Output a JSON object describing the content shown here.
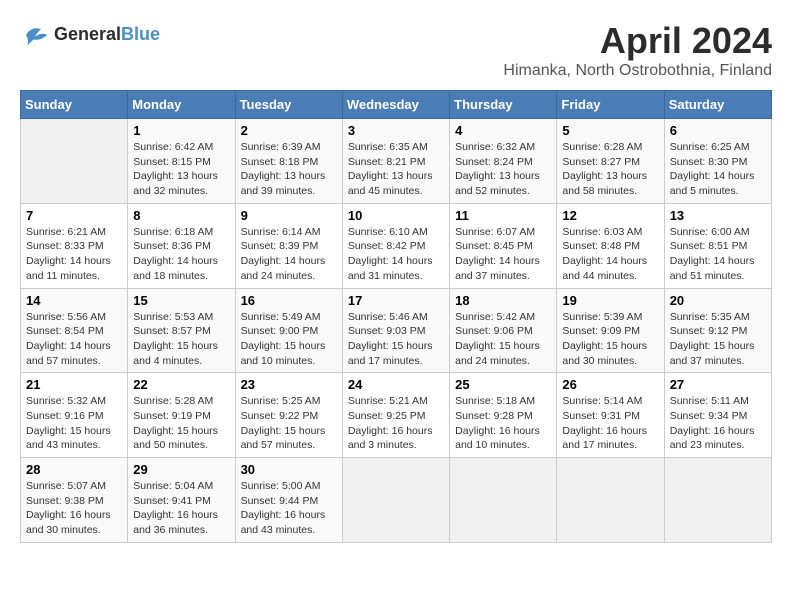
{
  "header": {
    "logo_line1": "General",
    "logo_line2": "Blue",
    "month": "April 2024",
    "location": "Himanka, North Ostrobothnia, Finland"
  },
  "weekdays": [
    "Sunday",
    "Monday",
    "Tuesday",
    "Wednesday",
    "Thursday",
    "Friday",
    "Saturday"
  ],
  "weeks": [
    [
      {
        "day": "",
        "info": ""
      },
      {
        "day": "1",
        "info": "Sunrise: 6:42 AM\nSunset: 8:15 PM\nDaylight: 13 hours\nand 32 minutes."
      },
      {
        "day": "2",
        "info": "Sunrise: 6:39 AM\nSunset: 8:18 PM\nDaylight: 13 hours\nand 39 minutes."
      },
      {
        "day": "3",
        "info": "Sunrise: 6:35 AM\nSunset: 8:21 PM\nDaylight: 13 hours\nand 45 minutes."
      },
      {
        "day": "4",
        "info": "Sunrise: 6:32 AM\nSunset: 8:24 PM\nDaylight: 13 hours\nand 52 minutes."
      },
      {
        "day": "5",
        "info": "Sunrise: 6:28 AM\nSunset: 8:27 PM\nDaylight: 13 hours\nand 58 minutes."
      },
      {
        "day": "6",
        "info": "Sunrise: 6:25 AM\nSunset: 8:30 PM\nDaylight: 14 hours\nand 5 minutes."
      }
    ],
    [
      {
        "day": "7",
        "info": "Sunrise: 6:21 AM\nSunset: 8:33 PM\nDaylight: 14 hours\nand 11 minutes."
      },
      {
        "day": "8",
        "info": "Sunrise: 6:18 AM\nSunset: 8:36 PM\nDaylight: 14 hours\nand 18 minutes."
      },
      {
        "day": "9",
        "info": "Sunrise: 6:14 AM\nSunset: 8:39 PM\nDaylight: 14 hours\nand 24 minutes."
      },
      {
        "day": "10",
        "info": "Sunrise: 6:10 AM\nSunset: 8:42 PM\nDaylight: 14 hours\nand 31 minutes."
      },
      {
        "day": "11",
        "info": "Sunrise: 6:07 AM\nSunset: 8:45 PM\nDaylight: 14 hours\nand 37 minutes."
      },
      {
        "day": "12",
        "info": "Sunrise: 6:03 AM\nSunset: 8:48 PM\nDaylight: 14 hours\nand 44 minutes."
      },
      {
        "day": "13",
        "info": "Sunrise: 6:00 AM\nSunset: 8:51 PM\nDaylight: 14 hours\nand 51 minutes."
      }
    ],
    [
      {
        "day": "14",
        "info": "Sunrise: 5:56 AM\nSunset: 8:54 PM\nDaylight: 14 hours\nand 57 minutes."
      },
      {
        "day": "15",
        "info": "Sunrise: 5:53 AM\nSunset: 8:57 PM\nDaylight: 15 hours\nand 4 minutes."
      },
      {
        "day": "16",
        "info": "Sunrise: 5:49 AM\nSunset: 9:00 PM\nDaylight: 15 hours\nand 10 minutes."
      },
      {
        "day": "17",
        "info": "Sunrise: 5:46 AM\nSunset: 9:03 PM\nDaylight: 15 hours\nand 17 minutes."
      },
      {
        "day": "18",
        "info": "Sunrise: 5:42 AM\nSunset: 9:06 PM\nDaylight: 15 hours\nand 24 minutes."
      },
      {
        "day": "19",
        "info": "Sunrise: 5:39 AM\nSunset: 9:09 PM\nDaylight: 15 hours\nand 30 minutes."
      },
      {
        "day": "20",
        "info": "Sunrise: 5:35 AM\nSunset: 9:12 PM\nDaylight: 15 hours\nand 37 minutes."
      }
    ],
    [
      {
        "day": "21",
        "info": "Sunrise: 5:32 AM\nSunset: 9:16 PM\nDaylight: 15 hours\nand 43 minutes."
      },
      {
        "day": "22",
        "info": "Sunrise: 5:28 AM\nSunset: 9:19 PM\nDaylight: 15 hours\nand 50 minutes."
      },
      {
        "day": "23",
        "info": "Sunrise: 5:25 AM\nSunset: 9:22 PM\nDaylight: 15 hours\nand 57 minutes."
      },
      {
        "day": "24",
        "info": "Sunrise: 5:21 AM\nSunset: 9:25 PM\nDaylight: 16 hours\nand 3 minutes."
      },
      {
        "day": "25",
        "info": "Sunrise: 5:18 AM\nSunset: 9:28 PM\nDaylight: 16 hours\nand 10 minutes."
      },
      {
        "day": "26",
        "info": "Sunrise: 5:14 AM\nSunset: 9:31 PM\nDaylight: 16 hours\nand 17 minutes."
      },
      {
        "day": "27",
        "info": "Sunrise: 5:11 AM\nSunset: 9:34 PM\nDaylight: 16 hours\nand 23 minutes."
      }
    ],
    [
      {
        "day": "28",
        "info": "Sunrise: 5:07 AM\nSunset: 9:38 PM\nDaylight: 16 hours\nand 30 minutes."
      },
      {
        "day": "29",
        "info": "Sunrise: 5:04 AM\nSunset: 9:41 PM\nDaylight: 16 hours\nand 36 minutes."
      },
      {
        "day": "30",
        "info": "Sunrise: 5:00 AM\nSunset: 9:44 PM\nDaylight: 16 hours\nand 43 minutes."
      },
      {
        "day": "",
        "info": ""
      },
      {
        "day": "",
        "info": ""
      },
      {
        "day": "",
        "info": ""
      },
      {
        "day": "",
        "info": ""
      }
    ]
  ]
}
